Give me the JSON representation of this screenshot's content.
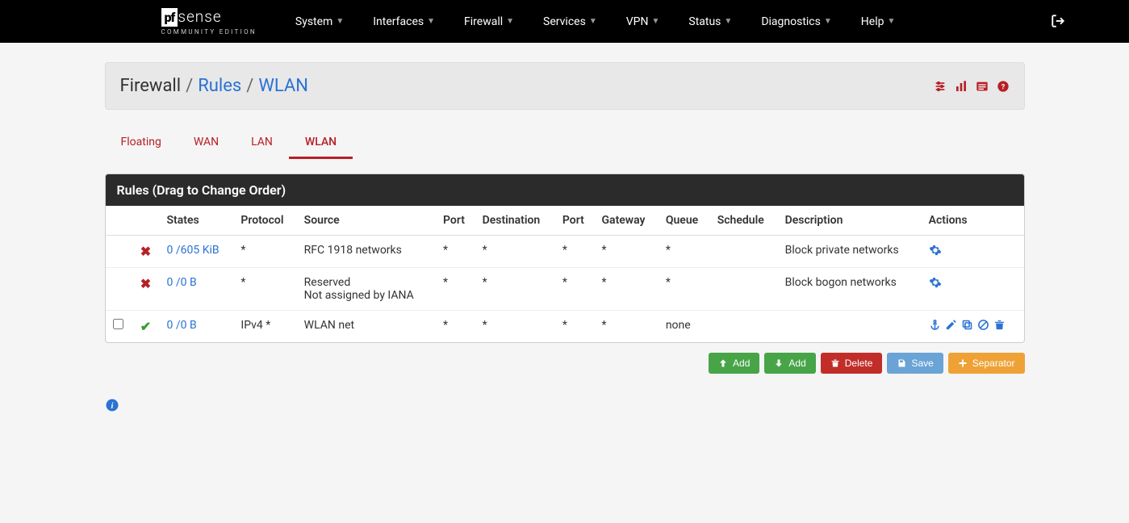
{
  "logo": {
    "box": "pf",
    "text": "sense",
    "sub": "COMMUNITY EDITION"
  },
  "nav": {
    "items": [
      "System",
      "Interfaces",
      "Firewall",
      "Services",
      "VPN",
      "Status",
      "Diagnostics",
      "Help"
    ]
  },
  "breadcrumb": {
    "main": "Firewall",
    "link1": "Rules",
    "link2": "WLAN"
  },
  "tabs": [
    "Floating",
    "WAN",
    "LAN",
    "WLAN"
  ],
  "active_tab": "WLAN",
  "panel_title": "Rules (Drag to Change Order)",
  "columns": {
    "chk": "",
    "status": "",
    "states": "States",
    "protocol": "Protocol",
    "source": "Source",
    "port1": "Port",
    "destination": "Destination",
    "port2": "Port",
    "gateway": "Gateway",
    "queue": "Queue",
    "schedule": "Schedule",
    "description": "Description",
    "actions": "Actions"
  },
  "rows": [
    {
      "status": "block",
      "states": "0 /605 KiB",
      "protocol": "*",
      "source": "RFC 1918 networks",
      "source2": "",
      "port1": "*",
      "destination": "*",
      "port2": "*",
      "gateway": "*",
      "queue": "*",
      "schedule": "",
      "description": "Block private networks",
      "gear": true,
      "chk": false
    },
    {
      "status": "block",
      "states": "0 /0 B",
      "protocol": "*",
      "source": "Reserved",
      "source2": "Not assigned by IANA",
      "port1": "*",
      "destination": "*",
      "port2": "*",
      "gateway": "*",
      "queue": "*",
      "schedule": "",
      "description": "Block bogon networks",
      "gear": true,
      "chk": false
    },
    {
      "status": "pass",
      "states": "0 /0 B",
      "protocol": "IPv4 *",
      "source": "WLAN net",
      "source2": "",
      "port1": "*",
      "destination": "*",
      "port2": "*",
      "gateway": "*",
      "queue": "none",
      "schedule": "",
      "description": "",
      "gear": false,
      "chk": true
    }
  ],
  "buttons": {
    "add1": "Add",
    "add2": "Add",
    "delete": "Delete",
    "save": "Save",
    "separator": "Separator"
  }
}
